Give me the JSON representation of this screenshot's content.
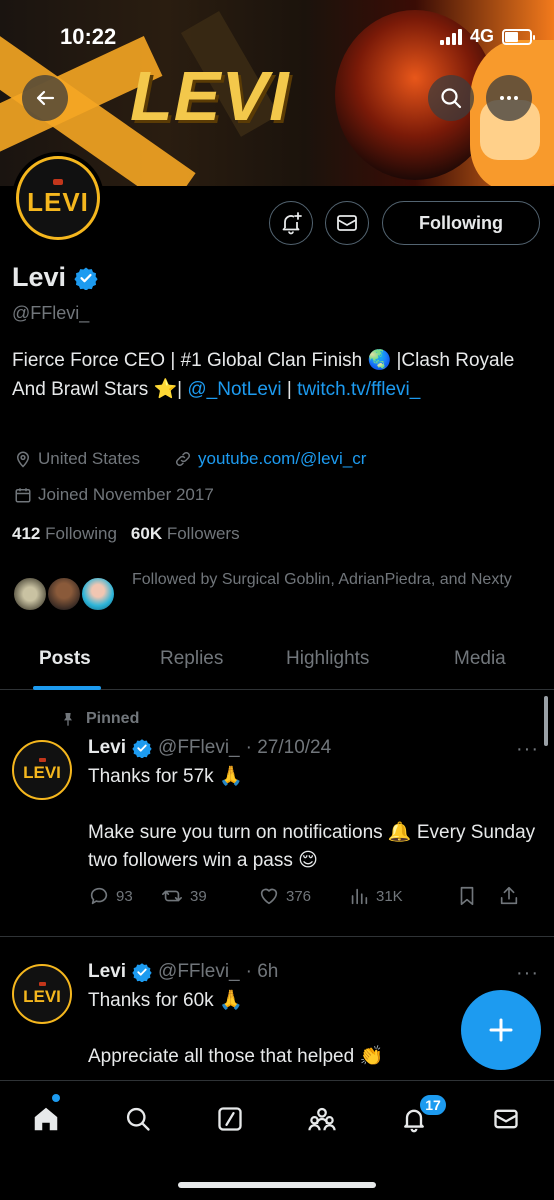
{
  "status": {
    "time": "10:22",
    "network": "4G",
    "battery_level": 0.55
  },
  "banner": {
    "logo_text": "LEVI"
  },
  "profile": {
    "avatar_text": "LEVI",
    "name": "Levi",
    "handle": "@FFlevi_",
    "bio_text": "Fierce Force CEO | #1 Global Clan Finish 🌏 |Clash Royale And Brawl Stars ⭐️| ",
    "bio_mention": "@_NotLevi",
    "bio_sep": " | ",
    "bio_link": "twitch.tv/fflevi_",
    "location": "United States",
    "website": "youtube.com/@levi_cr",
    "joined": "Joined November 2017",
    "following_count": "412",
    "following_label": "Following",
    "followers_count": "60K",
    "followers_label": "Followers",
    "followed_by": "Followed by Surgical Goblin, AdrianPiedra, and Nexty",
    "follow_button": "Following"
  },
  "tabs": [
    "Posts",
    "Replies",
    "Highlights",
    "Media"
  ],
  "active_tab": "Posts",
  "posts": [
    {
      "pinned_label": "Pinned",
      "avatar_text": "LEVI",
      "name": "Levi",
      "handle": "@FFlevi_",
      "time": "· 27/10/24",
      "line1": "Thanks for 57k 🙏",
      "line2": "Make sure you turn on notifications 🔔 Every Sunday two followers win a pass 😌",
      "replies": "93",
      "reposts": "39",
      "likes": "376",
      "views": "31K"
    },
    {
      "avatar_text": "LEVI",
      "name": "Levi",
      "handle": "@FFlevi_",
      "time": "· 6h",
      "line1": "Thanks for 60k 🙏",
      "line2": "Appreciate all those that helped 👏"
    }
  ],
  "notifications_badge": "17",
  "colors": {
    "accent": "#1d9bf0",
    "gold": "#f5b71e",
    "background": "#000000",
    "muted": "#71767b"
  }
}
